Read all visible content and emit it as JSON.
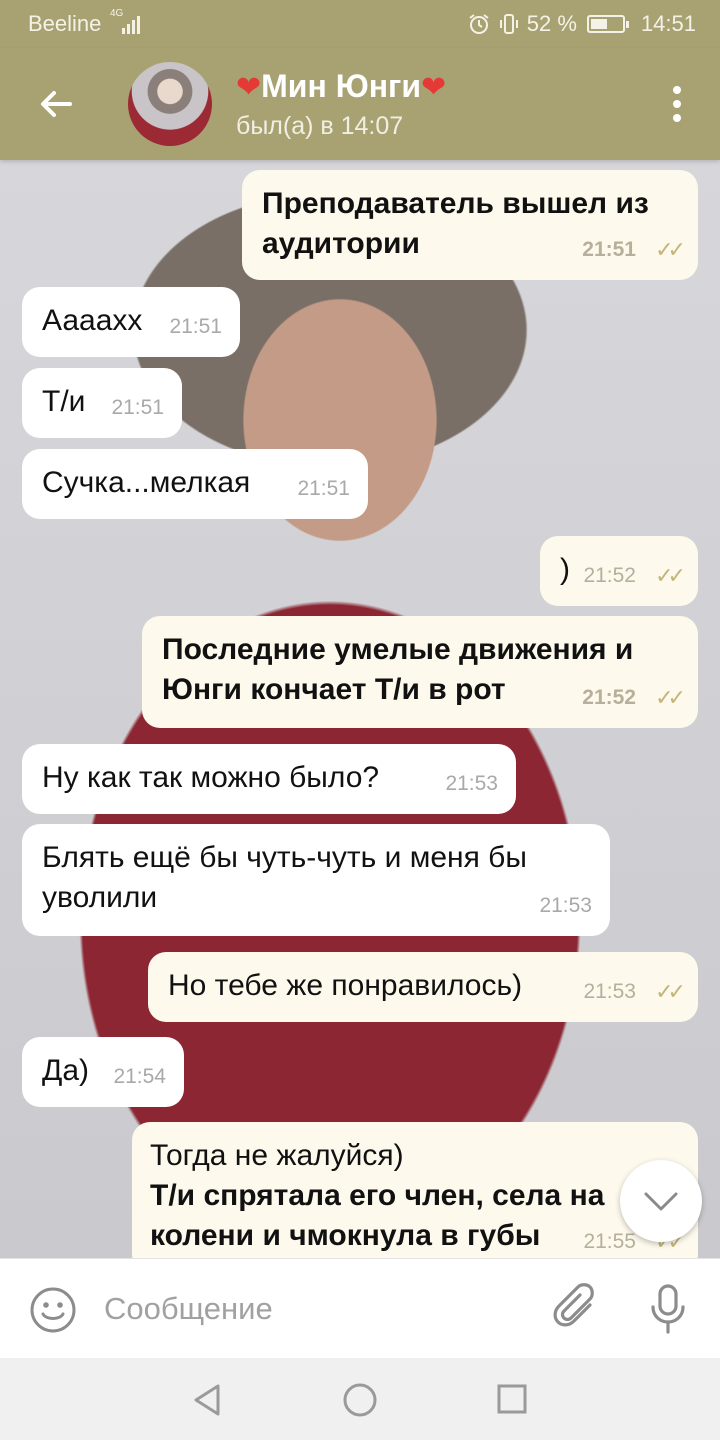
{
  "status_bar": {
    "carrier": "Beeline",
    "network": "4G",
    "battery": "52 %",
    "battery_level": 0.52,
    "time": "14:51"
  },
  "header": {
    "title": "Мин Юнги",
    "heart": "❤",
    "status": "был(а) в 14:07"
  },
  "messages": [
    {
      "dir": "out",
      "text": "Преподаватель вышел из аудитории",
      "time": "21:51"
    },
    {
      "dir": "in",
      "text": "Аааaхх",
      "time": "21:51"
    },
    {
      "dir": "in",
      "text": "Т/и",
      "time": "21:51"
    },
    {
      "dir": "in",
      "text": "Сучка...мелкая",
      "time": "21:51"
    },
    {
      "dir": "out",
      "text": ")",
      "time": "21:52"
    },
    {
      "dir": "out",
      "text": "Последние умелые движения и Юнги кончает Т/и в рот",
      "time": "21:52"
    },
    {
      "dir": "in",
      "text": "Ну как так можно было?",
      "time": "21:53"
    },
    {
      "dir": "in",
      "text": "Блять ещё бы чуть-чуть и меня бы уволили",
      "time": "21:53"
    },
    {
      "dir": "out",
      "text": "Но тебе же понравилось)",
      "time": "21:53"
    },
    {
      "dir": "in",
      "text": "Да)",
      "time": "21:54"
    },
    {
      "dir": "out",
      "text_line1": "Тогда не жалуйся)",
      "text_bold": "Т/и спрятала его член, села на колени и чмокнула в губы",
      "time": "21:55"
    }
  ],
  "input": {
    "placeholder": "Сообщение"
  }
}
